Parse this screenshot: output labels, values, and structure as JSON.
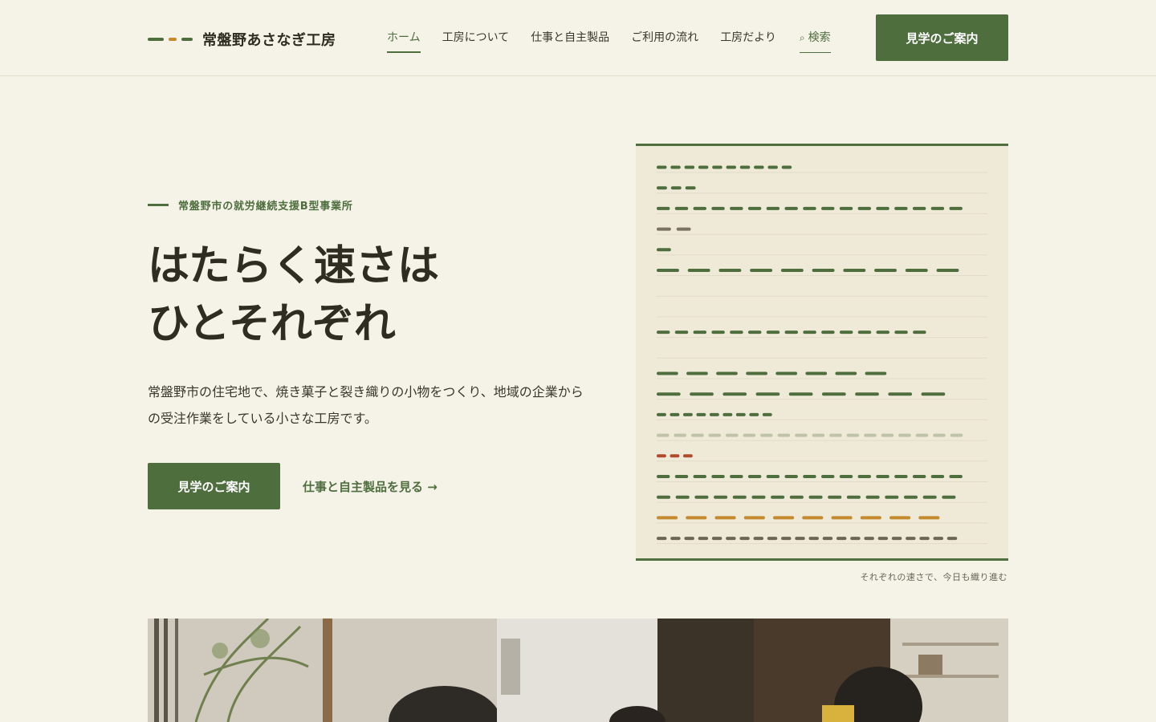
{
  "brand": {
    "name": "常盤野あさなぎ工房",
    "mark_colors": [
      "#4e6e3e",
      "#c58a2e",
      "#4e6e3e"
    ]
  },
  "nav": {
    "items": [
      {
        "label": "ホーム",
        "active": true
      },
      {
        "label": "工房について",
        "active": false
      },
      {
        "label": "仕事と自主製品",
        "active": false
      },
      {
        "label": "ご利用の流れ",
        "active": false
      },
      {
        "label": "工房だより",
        "active": false
      }
    ],
    "search_label": "検索",
    "search_icon": "search-icon",
    "cta_label": "見学のご案内"
  },
  "hero": {
    "eyebrow": "常盤野市の就労継続支援B型事業所",
    "title_line1": "はたらく速さは",
    "title_line2": "ひとそれぞれ",
    "description": "常盤野市の住宅地で、焼き菓子と裂き織りの小物をつくり、地域の企業からの受注作業をしている小さな工房です。",
    "primary_button": "見学のご案内",
    "secondary_link": "仕事と自主製品を見る →"
  },
  "weave": {
    "caption": "それぞれの速さで、今日も織り進む",
    "rows": [
      {
        "color": "#4e6e3e",
        "count": 10,
        "length": 0.42,
        "opacity": 1
      },
      {
        "color": "#4e6e3e",
        "count": 3,
        "length": 0.13,
        "opacity": 1
      },
      {
        "color": "#4e6e3e",
        "count": 17,
        "length": 0.94,
        "opacity": 1
      },
      {
        "color": "#7a7263",
        "count": 2,
        "length": 0.12,
        "opacity": 1
      },
      {
        "color": "#4e6e3e",
        "count": 1,
        "length": 0.06,
        "opacity": 1
      },
      {
        "color": "#4e6e3e",
        "count": 10,
        "length": 0.94,
        "opacity": 1
      },
      {
        "color": "#4e6e3e",
        "count": 0,
        "length": 0,
        "opacity": 1
      },
      {
        "color": "#4e6e3e",
        "count": 0,
        "length": 0,
        "opacity": 1
      },
      {
        "color": "#4e6e3e",
        "count": 15,
        "length": 0.83,
        "opacity": 1
      },
      {
        "color": "#4e6e3e",
        "count": 0,
        "length": 0,
        "opacity": 1
      },
      {
        "color": "#4e6e3e",
        "count": 8,
        "length": 0.72,
        "opacity": 1
      },
      {
        "color": "#4e6e3e",
        "count": 9,
        "length": 0.9,
        "opacity": 1
      },
      {
        "color": "#4e6e3e",
        "count": 9,
        "length": 0.36,
        "opacity": 1
      },
      {
        "color": "#4e6e3e",
        "count": 18,
        "length": 0.94,
        "opacity": 0.3
      },
      {
        "color": "#b24a2e",
        "count": 3,
        "length": 0.12,
        "opacity": 1
      },
      {
        "color": "#4e6e3e",
        "count": 17,
        "length": 0.94,
        "opacity": 1
      },
      {
        "color": "#4e6e3e",
        "count": 16,
        "length": 0.92,
        "opacity": 1
      },
      {
        "color": "#c58a2e",
        "count": 10,
        "length": 0.88,
        "opacity": 1
      },
      {
        "color": "#6b6656",
        "count": 22,
        "length": 0.92,
        "opacity": 1
      }
    ]
  }
}
